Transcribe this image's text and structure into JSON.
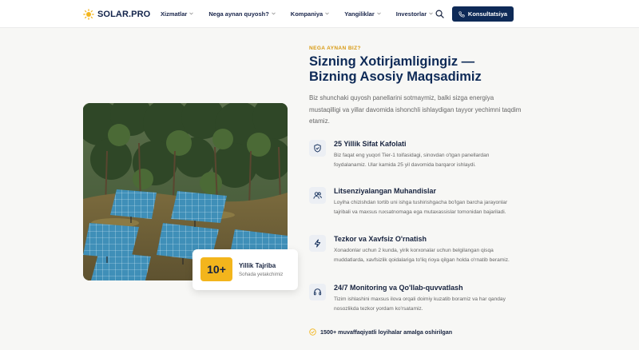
{
  "brand": {
    "name": "SOLAR.PRO"
  },
  "nav": {
    "items": [
      {
        "label": "Xizmatlar"
      },
      {
        "label": "Nega aynan quyosh?"
      },
      {
        "label": "Kompaniya"
      },
      {
        "label": "Yangiliklar"
      },
      {
        "label": "Investorlar"
      }
    ],
    "search_icon": "search-icon",
    "cta_label": "Konsultatsiya"
  },
  "badge": {
    "number": "10+",
    "title": "Yillik Tajriba",
    "subtitle": "Sohada yetakchimiz"
  },
  "section": {
    "eyebrow": "NEGA AYNAN BIZ?",
    "headline_line1": "Sizning Xotirjamligingiz —",
    "headline_line2": "Bizning Asosiy Maqsadimiz",
    "intro": "Biz shunchaki quyosh panellarini sotmaymiz, balki sizga energiya mustaqilligi va yillar davomida ishonchli ishlaydigan tayyor yechimni taqdim etamiz."
  },
  "features": [
    {
      "icon": "shield-icon",
      "title": "25 Yillik Sifat Kafolati",
      "desc": "Biz faqat eng yuqori Tier-1 toifasidagi, sinovdan o'tgan panellardan foydalanamiz. Ular kamida 25 yil davomida barqaror ishlaydi."
    },
    {
      "icon": "users-icon",
      "title": "Litsenziyalangan Muhandislar",
      "desc": "Loyiha chizishdan tortib uni ishga tushirishgacha bo'lgan barcha jarayonlar tajribali va maxsus ruxsatnomaga ega mutaxassislar tomonidan bajariladi."
    },
    {
      "icon": "lightning-icon",
      "title": "Tezkor va Xavfsiz O'rnatish",
      "desc": "Xonadonlar uchun 2 kunda, yirik korxonalar uchun belgilangan qisqa muddatlarda, xavfsizlik qoidalariga to'liq rioya qilgan holda o'rnatib beramiz."
    },
    {
      "icon": "headset-icon",
      "title": "24/7 Monitoring va Qo'llab-quvvatlash",
      "desc": "Tizim ishlashini maxsus ilova orqali doimiy kuzatib boramiz va har qanday nosozlikda tezkor yordam ko'rsatamiz."
    }
  ],
  "footnote": {
    "icon": "check-circle-icon",
    "text": "1500+ muvaffaqiyatli loyihalar amalga oshirilgan"
  },
  "colors": {
    "navy": "#0e2a57",
    "accent": "#f3b51c",
    "eyebrow": "#d89a12"
  }
}
